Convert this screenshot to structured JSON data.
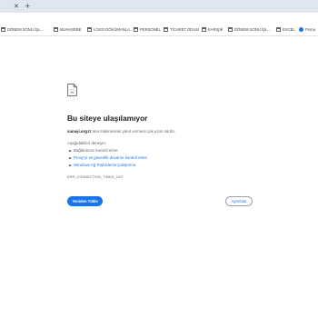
{
  "browser": {
    "tab_close_glyph": "✕",
    "new_tab_glyph": "+",
    "bookmarks": [
      {
        "label": "DÖNEM SONU İŞL...",
        "icon": "folder-icon"
      },
      {
        "label": "MUHASEBE",
        "icon": "folder-icon"
      },
      {
        "label": "LOGO DÖKÜMANLA...",
        "icon": "folder-icon"
      },
      {
        "label": "PERSONEL",
        "icon": "folder-icon"
      },
      {
        "label": "TİCARET ODASI",
        "icon": "folder-icon"
      },
      {
        "label": "KARIŞIK",
        "icon": "folder-icon"
      },
      {
        "label": "DÖNEM SONU İŞL...",
        "icon": "folder-icon"
      },
      {
        "label": "EXCEL",
        "icon": "folder-icon"
      },
      {
        "label": "Pınna",
        "icon": "globe-icon"
      }
    ]
  },
  "error_page": {
    "title": "Bu siteye ulaşılamıyor",
    "host": "sanayi.org.tr",
    "message": " ana makinesinin yanıt vermesi çok uzun sürdü.",
    "try_label": "Aşağıdakileri deneyin:",
    "suggestions": [
      {
        "text": "Bağlantınızı kontrol etme",
        "link": false
      },
      {
        "text": "Proxy'yi ve güvenlik duvarını kontrol etme",
        "link": true
      },
      {
        "text": "Windows Ağ Teşhislerini Çalıştırma",
        "link": true
      }
    ],
    "error_code": "ERR_CONNECTION_TIMED_OUT",
    "reload_label": "Yeniden Yükle",
    "details_label": "Ayrıntılar"
  },
  "colors": {
    "accent": "#1a73e8",
    "titlebar": "#dfe6f2",
    "text_primary": "#202124",
    "text_secondary": "#5f6368"
  }
}
